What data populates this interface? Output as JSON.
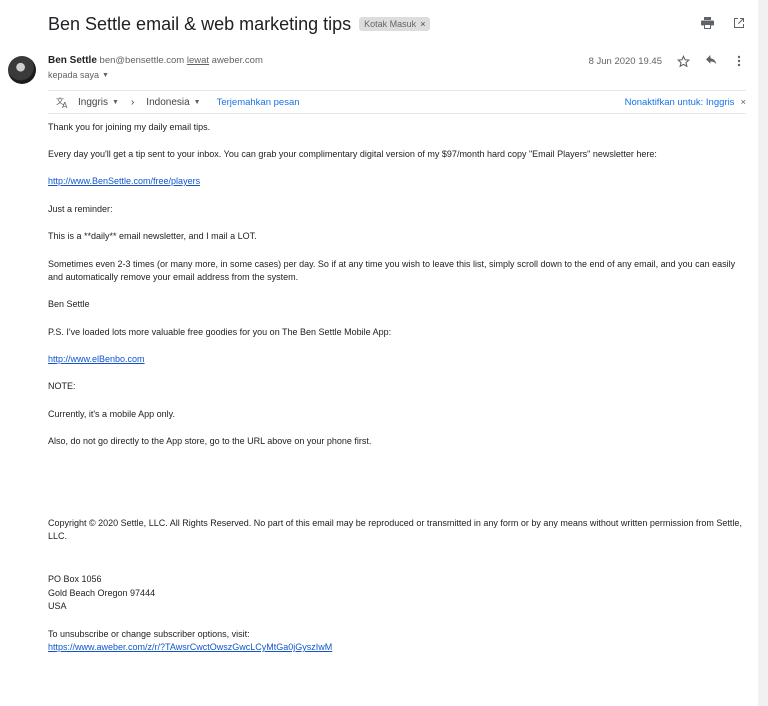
{
  "header": {
    "subject": "Ben Settle email & web marketing tips",
    "label_chip": "Kotak Masuk",
    "label_chip_close": "×"
  },
  "sender": {
    "name": "Ben Settle",
    "email": "ben@bensettle.com",
    "via_text": "lewat",
    "via_domain": "aweber.com",
    "to_text": "kepada saya",
    "date": "8 Jun 2020 19.45"
  },
  "translate_bar": {
    "source_lang": "Inggris",
    "arrow": "›",
    "target_lang": "Indonesia",
    "translate_link": "Terjemahkan pesan",
    "disable_text": "Nonaktifkan untuk: Inggris",
    "close": "×"
  },
  "body": {
    "p1": "Thank you for joining my daily email tips.",
    "p2": "Every day you'll get a tip sent to your inbox. You can grab your complimentary digital version of my $97/month hard copy \"Email Players\" newsletter here:",
    "link1": "http://www.BenSettle.com/free/players",
    "p3": "Just a reminder:",
    "p4": "This is a **daily** email newsletter, and I mail a LOT.",
    "p5": "Sometimes even 2-3 times (or many more, in some cases) per day. So if at any time you wish to leave this list, simply scroll down to the end of any email, and you can easily and automatically remove your email address from the system.",
    "p6": "Ben Settle",
    "p7": "P.S. I've loaded lots more valuable free goodies for you on The Ben Settle Mobile App:",
    "link2": "http://www.elBenbo.com",
    "p8": "NOTE:",
    "p9": "Currently, it's a mobile App only.",
    "p10": "Also, do not go directly to the App store, go to the URL above on your phone first.",
    "copyright": "Copyright © 2020 Settle, LLC. All Rights Reserved. No part of this email may be reproduced or transmitted in any form or by any means without written permission from Settle, LLC.",
    "address_line1": "PO Box 1056",
    "address_line2": "Gold Beach Oregon 97444",
    "address_line3": "USA",
    "unsubscribe_text": "To unsubscribe or change subscriber options, visit:",
    "unsubscribe_link": "https://www.aweber.com/z/r/?TAwsrCwctOwszGwcLCyMtGa0jGyszIwM"
  },
  "icons": {
    "print": "print-icon",
    "open_new_window": "open-in-new-window-icon",
    "star": "star-icon",
    "reply": "reply-icon",
    "more": "more-vert-icon",
    "translate": "translate-icon"
  },
  "colors": {
    "link": "#1155cc",
    "accent_blue": "#1a73e8",
    "label_chip_bg": "#dddddd"
  }
}
